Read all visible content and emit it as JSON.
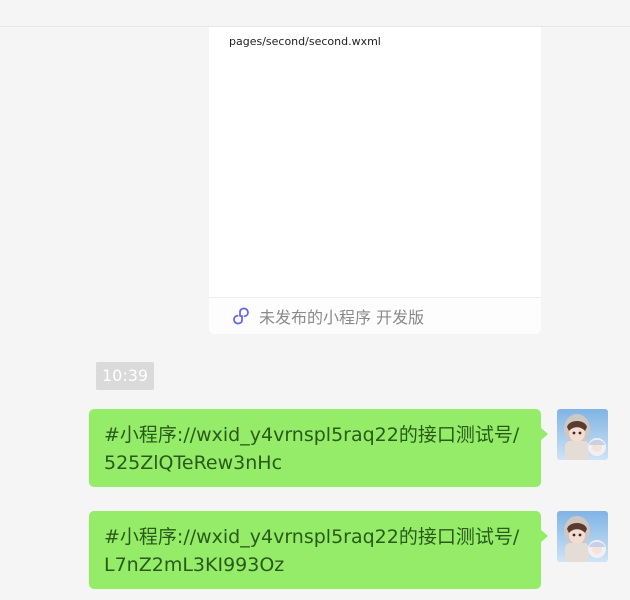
{
  "mini_program_card": {
    "path": "pages/second/second.wxml",
    "footer_label": "未发布的小程序 开发版",
    "icon": "mini-program-icon"
  },
  "time_divider": "10:39",
  "messages": [
    {
      "sender": "self",
      "avatar": "user-avatar",
      "line1": "#小程序://wxid_y4vrnspl5raq22的接口测试号/",
      "line2": "525ZlQTeRew3nHc"
    },
    {
      "sender": "self",
      "avatar": "user-avatar",
      "line1": "#小程序://wxid_y4vrnspl5raq22的接口测试号/",
      "line2": "L7nZ2mL3KI993Oz"
    }
  ],
  "colors": {
    "background": "#f5f5f5",
    "bubble_self": "#95ec69",
    "bubble_text": "#2a5a1a",
    "time_badge": "#dadada",
    "mini_program_icon": "#6467f0"
  }
}
